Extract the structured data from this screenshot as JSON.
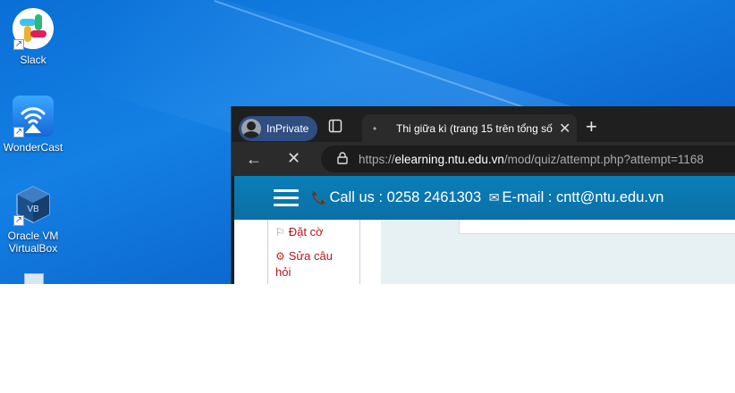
{
  "desktop": {
    "icons": [
      {
        "label": "Slack",
        "icon": "slack-icon"
      },
      {
        "label": "WonderCast",
        "icon": "wondercast-icon"
      },
      {
        "label_line1": "Oracle VM",
        "label_line2": "VirtualBox",
        "icon": "virtualbox-icon"
      }
    ]
  },
  "browser": {
    "profile_label": "InPrivate",
    "tab_title": "Thi giữa kì (trang 15 trên tổng số",
    "address": {
      "scheme": "https://",
      "host": "elearning.ntu.edu.vn",
      "path": "/mod/quiz/attempt.php?attempt=1168"
    }
  },
  "site": {
    "phone_text": "Call us : 0258 2461303",
    "email_text": "E-mail : cntt@ntu.edu.vn",
    "side_links": {
      "flag_label": "Đặt cờ",
      "edit_label_line1": "Sửa câu",
      "edit_label_line2": "hỏi"
    }
  },
  "colors": {
    "desktop_bg": "#0b6fd8",
    "browser_chrome": "#1f1f1f",
    "site_header": "#0b76ae",
    "link_red": "#b3161d"
  }
}
